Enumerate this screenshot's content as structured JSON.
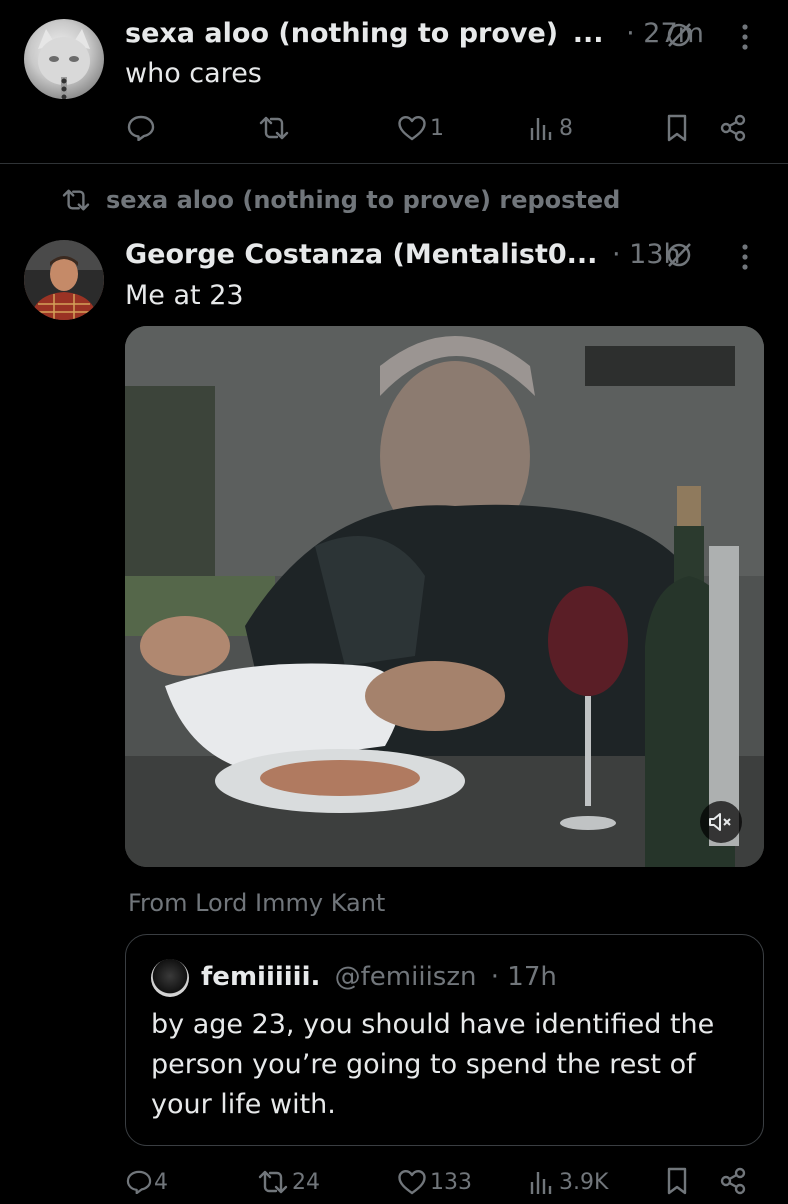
{
  "tweet1": {
    "author": "sexa aloo (nothing to prove)",
    "ellipsis": "...",
    "time": "· 27m",
    "text": "who cares",
    "actions": {
      "likes": "1",
      "views": "8"
    }
  },
  "repost": {
    "label": "sexa aloo (nothing to prove) reposted"
  },
  "tweet2": {
    "author": "George Costanza (Mentalist0...",
    "time": "· 13h",
    "text": "Me at 23",
    "from": "From Lord Immy Kant",
    "quote": {
      "name": "femiiiiii.",
      "handle": "@femiiiszn",
      "time": "· 17h",
      "text": "by age 23, you should have identified the person you’re going to spend the rest of your life with."
    },
    "actions": {
      "replies": "4",
      "reposts": "24",
      "likes": "133",
      "views": "3.9K"
    }
  },
  "colors": {
    "background": "#000000",
    "text": "#e7e9ea",
    "muted": "#71767b",
    "divider": "#2f3336"
  }
}
